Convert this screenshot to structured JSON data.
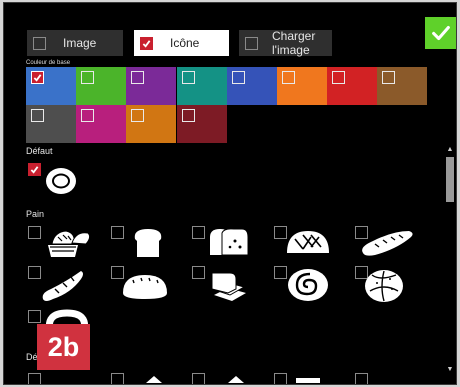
{
  "toolbar": {
    "image_label": "Image",
    "icon_label": "Icône",
    "upload_label": "Charger l'image",
    "ok_icon": "check-icon"
  },
  "colors": {
    "section_label": "Couleur de base",
    "swatches": [
      {
        "color": "#3a72c9",
        "checked": true
      },
      {
        "color": "#4bb42a",
        "checked": false
      },
      {
        "color": "#7b2a98",
        "checked": false
      },
      {
        "color": "#149285",
        "checked": false
      },
      {
        "color": "#3553b8",
        "checked": false
      },
      {
        "color": "#f0771e",
        "checked": false
      },
      {
        "color": "#d22224",
        "checked": false
      },
      {
        "color": "#8b5a2a",
        "checked": false
      },
      {
        "color": "#4e4e4e",
        "checked": false
      },
      {
        "color": "#b81f7d",
        "checked": false
      },
      {
        "color": "#d17613",
        "checked": false
      },
      {
        "color": "#7d1b25",
        "checked": false
      }
    ]
  },
  "sections": {
    "default_label": "Défaut",
    "bread_label": "Pain",
    "next_label": "Dé"
  },
  "icons": {
    "default": [
      {
        "name": "plate-icon",
        "checked": true
      }
    ],
    "bread": [
      {
        "name": "bread-basket-icon"
      },
      {
        "name": "toast-slice-icon"
      },
      {
        "name": "sliced-loaf-icon"
      },
      {
        "name": "round-loaf-icon"
      },
      {
        "name": "baguette-icon"
      },
      {
        "name": "croissant-icon"
      },
      {
        "name": "oval-loaf-icon"
      },
      {
        "name": "sliced-bread-stack-icon"
      },
      {
        "name": "cinnamon-roll-icon"
      },
      {
        "name": "bread-roll-icon"
      },
      {
        "name": "pretzel-icon"
      }
    ]
  },
  "badge": "2b"
}
